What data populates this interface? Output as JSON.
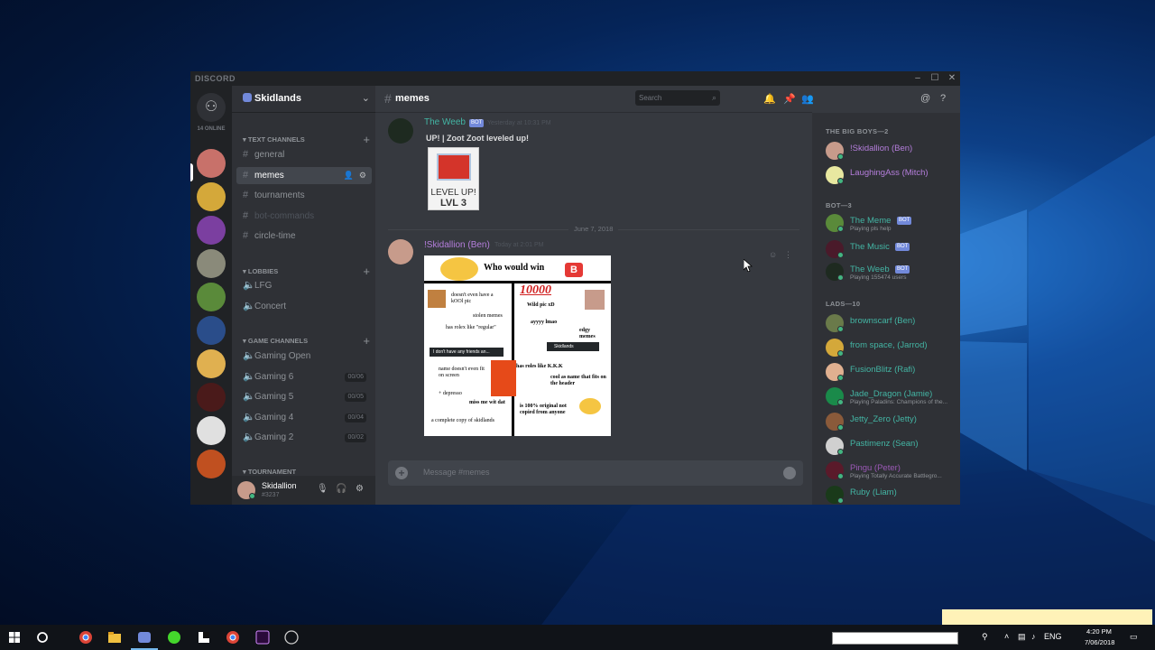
{
  "window": {
    "brand": "DISCORD"
  },
  "guilds": {
    "online_count": "14 ONLINE"
  },
  "server": {
    "name": "Skidlands"
  },
  "channels": {
    "text_category": "TEXT CHANNELS",
    "text": [
      {
        "name": "general"
      },
      {
        "name": "memes"
      },
      {
        "name": "tournaments"
      },
      {
        "name": "bot-commands"
      },
      {
        "name": "circle-time"
      }
    ],
    "lobbies_category": "LOBBIES",
    "lobbies": [
      {
        "name": "LFG"
      },
      {
        "name": "Concert"
      }
    ],
    "game_category": "GAME CHANNELS",
    "games": [
      {
        "name": "Gaming Open",
        "count": ""
      },
      {
        "name": "Gaming 6",
        "count": "00/06"
      },
      {
        "name": "Gaming 5",
        "count": "00/05"
      },
      {
        "name": "Gaming 4",
        "count": "00/04"
      },
      {
        "name": "Gaming 2",
        "count": "00/02"
      }
    ],
    "tournament_category": "TOURNAMENT"
  },
  "user": {
    "name": "Skidallion",
    "tag": "#3237"
  },
  "chat": {
    "channel": "memes",
    "search_placeholder": "Search",
    "composer_placeholder": "Message #memes",
    "divider": "June 7, 2018",
    "messages": [
      {
        "author": "The Weeb",
        "bot": "BOT",
        "time": "Yesterday at 10:31 PM",
        "text": "UP! | Zoot Zoot leveled up!",
        "embed_line1": "LEVEL UP!",
        "embed_line2": "LVL 3"
      },
      {
        "author": "!Skidallion (Ben)",
        "time": "Today at 2:01 PM"
      }
    ]
  },
  "meme": {
    "title": "Who would win",
    "b": "B",
    "number": "10000",
    "left": [
      "doesn't even have a kOOl pic",
      "stolen memes",
      "has rolex like \"regular\"",
      "I don't have any friends an...",
      "name doesn't even fit on screen",
      "+ depresso",
      "miss me wit dat",
      "a complete copy of skidlands"
    ],
    "right": [
      "Wild pic xD",
      "ayyyy lmao",
      "edgy memes",
      "Skidlands",
      "has roles like K.K.K",
      "cool as name that fits on the header",
      "is 100% original not copied from anyone"
    ]
  },
  "members": {
    "groups": [
      {
        "label": "THE BIG BOYS—2",
        "members": [
          {
            "name": "!Skidallion (Ben)",
            "color": "#b57edc"
          },
          {
            "name": "LaughingAss (Mitch)",
            "color": "#b57edc"
          }
        ]
      },
      {
        "label": "BOT—3",
        "members": [
          {
            "name": "The Meme",
            "bot": "BOT",
            "playing": "Playing pls help",
            "color": "#43b5a4"
          },
          {
            "name": "The Music",
            "bot": "BOT",
            "color": "#43b5a4"
          },
          {
            "name": "The Weeb",
            "bot": "BOT",
            "playing": "Playing 155474 users",
            "color": "#43b5a4"
          }
        ]
      },
      {
        "label": "LADS—10",
        "members": [
          {
            "name": "brownscarf (Ben)",
            "color": "#43b5a4"
          },
          {
            "name": "from space, (Jarrod)",
            "color": "#43b5a4"
          },
          {
            "name": "FusionBlitz (Rafi)",
            "color": "#43b5a4"
          },
          {
            "name": "Jade_Dragon (Jamie)",
            "playing": "Playing Paladins: Champions of the...",
            "color": "#43b5a4"
          },
          {
            "name": "Jetty_Zero (Jetty)",
            "color": "#43b5a4"
          },
          {
            "name": "Pastimenz (Sean)",
            "color": "#43b5a4"
          },
          {
            "name": "Pingu (Peter)",
            "playing": "Playing Totally Accurate Battlegro...",
            "color": "#9b59b6"
          },
          {
            "name": "Ruby (Liam)",
            "color": "#43b5a4"
          }
        ]
      }
    ]
  },
  "taskbar": {
    "lang": "ENG",
    "time": "4:20 PM",
    "date": "7/06/2018"
  }
}
